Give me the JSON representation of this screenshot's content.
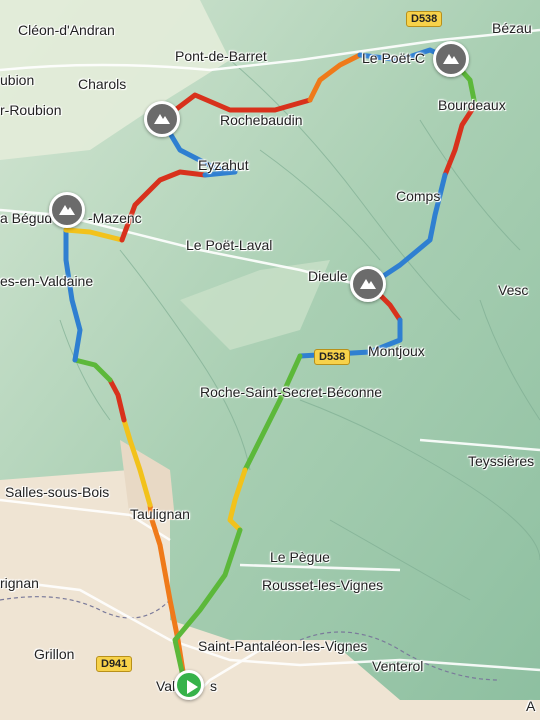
{
  "map": {
    "places": [
      {
        "name": "Cléon-d'Andran"
      },
      {
        "name": "Pont-de-Barret"
      },
      {
        "name": "Le Poët-Célard"
      },
      {
        "name": "Bézaudun"
      },
      {
        "name": "Charols"
      },
      {
        "name": "Roubion"
      },
      {
        "name": "Rochebaudin"
      },
      {
        "name": "Bourdeaux"
      },
      {
        "name": "Eyzahut"
      },
      {
        "name": "La Bégude-de-Mazenc"
      },
      {
        "name": "Comps"
      },
      {
        "name": "Le Poët-Laval"
      },
      {
        "name": "Dieulefit"
      },
      {
        "name": "Vesc"
      },
      {
        "name": "Montjoux"
      },
      {
        "name": "Souspierre / Valdaine"
      },
      {
        "name": "Roche-Saint-Secret-Béconne"
      },
      {
        "name": "Teyssières"
      },
      {
        "name": "Salles-sous-Bois"
      },
      {
        "name": "Taulignan"
      },
      {
        "name": "Le Pègue"
      },
      {
        "name": "Rousset-les-Vignes"
      },
      {
        "name": "Saint-Pantaléon-les-Vignes"
      },
      {
        "name": "Grignan"
      },
      {
        "name": "Grillon"
      },
      {
        "name": "Venterol"
      },
      {
        "name": "Valréas"
      }
    ],
    "labels": {
      "cleon": "Cléon-d'Andran",
      "pont_de_barret": "Pont-de-Barret",
      "poet_celard": "Le Poët-C",
      "bezaudun": "Bézau",
      "charols": "Charols",
      "roubion_1": "ubion",
      "roubion_2": "r-Roubion",
      "rochebaudin": "Rochebaudin",
      "bourdeaux": "Bourdeaux",
      "eyzahut": "Eyzahut",
      "begude": "a Bégud",
      "mazenc": "-Mazenc",
      "comps": "Comps",
      "poet_laval": "Le Poët-Laval",
      "dieulefit": "Dieule",
      "vesc": "Vesc",
      "valdaine": "es-en-Valdaine",
      "montjoux": "Montjoux",
      "roche_st_secret": "Roche-Saint-Secret-Béconne",
      "teyssieres": "Teyssières",
      "salles": "Salles-sous-Bois",
      "taulignan": "Taulignan",
      "le_pegue": "Le Pègue",
      "rousset": "Rousset-les-Vignes",
      "st_pantaleon": "Saint-Pantaléon-les-Vignes",
      "grignan": "rignan",
      "grillon": "Grillon",
      "venterol": "Venterol",
      "valreas": "Val",
      "valreas_tail": "s",
      "a_corner": "A"
    },
    "roads": {
      "d538_top": "D538",
      "d538_mid": "D538",
      "d941": "D941"
    },
    "markers": {
      "summits": [
        "summit-icon",
        "summit-icon",
        "summit-icon",
        "summit-icon"
      ],
      "start": "start-flag-icon"
    },
    "colors": {
      "route_blue": "#2f7fd1",
      "route_green": "#5cb83a",
      "route_yellow": "#f2c21b",
      "route_orange": "#ef7a1a",
      "route_red": "#d8311c",
      "terrain": "#b9d9bd",
      "farmland": "#efe4d3",
      "summit_marker": "#6b6b6b",
      "start_marker": "#36b24a",
      "road_badge": "#f7d24a"
    }
  }
}
